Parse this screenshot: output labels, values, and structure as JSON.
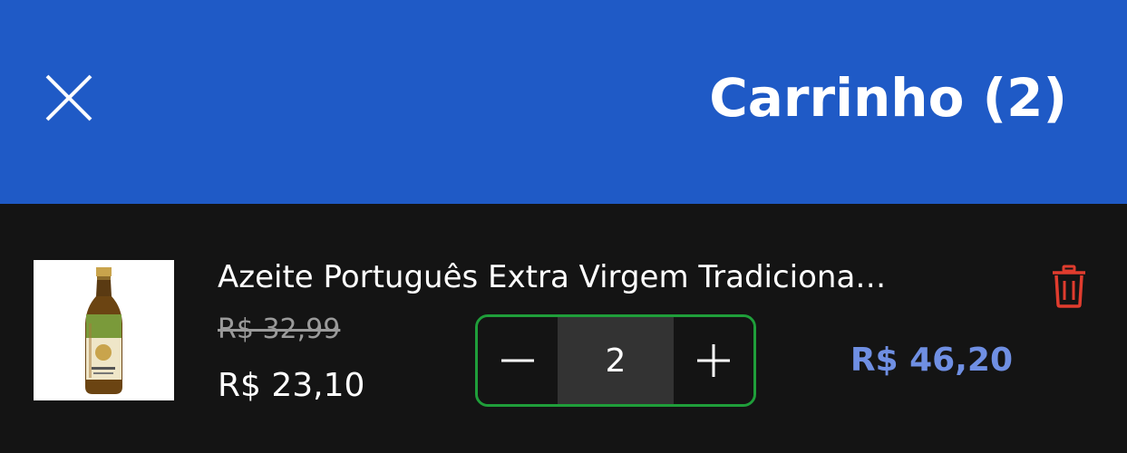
{
  "header": {
    "title": "Carrinho (2)",
    "close_icon": "close-icon"
  },
  "colors": {
    "header_bg": "#1f5ac6",
    "body_bg": "#141414",
    "stepper_border": "#1f9e3a",
    "total_price": "#6f8fe3",
    "trash": "#e03c2e"
  },
  "cart": {
    "items": [
      {
        "name": "Azeite Português Extra Virgem Tradiciona…",
        "old_price": "R$ 32,99",
        "price": "R$ 23,10",
        "quantity": "2",
        "total": "R$ 46,20",
        "decrement_icon": "minus-icon",
        "increment_icon": "plus-icon",
        "remove_icon": "trash-icon"
      }
    ]
  }
}
